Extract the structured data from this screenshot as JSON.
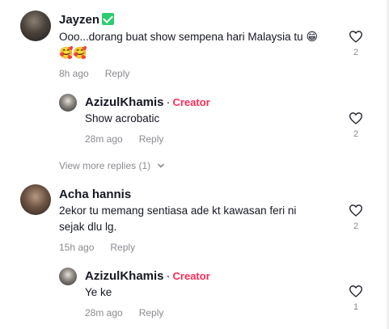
{
  "comments": [
    {
      "name": "Jayzen",
      "verified": true,
      "text": "Ooo...dorang buat show sempena hari Malaysia tu",
      "emoji_inline": "😁",
      "emoji_line2": "🥰🥰",
      "time": "8h ago",
      "reply_label": "Reply",
      "likes": "2",
      "view_more": "View more replies (1)",
      "replies": [
        {
          "name": "AzizulKhamis",
          "separator": "·",
          "badge": "Creator",
          "text": "Show acrobatic",
          "time": "28m ago",
          "reply_label": "Reply",
          "likes": "2"
        }
      ]
    },
    {
      "name": "Acha hannis",
      "text_line1": "2ekor tu memang sentiasa ade kt kawasan feri ni",
      "text_line2": "sejak dlu lg.",
      "time": "15h ago",
      "reply_label": "Reply",
      "likes": "2",
      "replies": [
        {
          "name": "AzizulKhamis",
          "separator": "·",
          "badge": "Creator",
          "text": "Ye ke",
          "time": "28m ago",
          "reply_label": "Reply",
          "likes": "1"
        }
      ]
    }
  ],
  "colors": {
    "creator": "#fe2c55",
    "verified": "#2ecc71",
    "muted": "#8a8b91"
  }
}
